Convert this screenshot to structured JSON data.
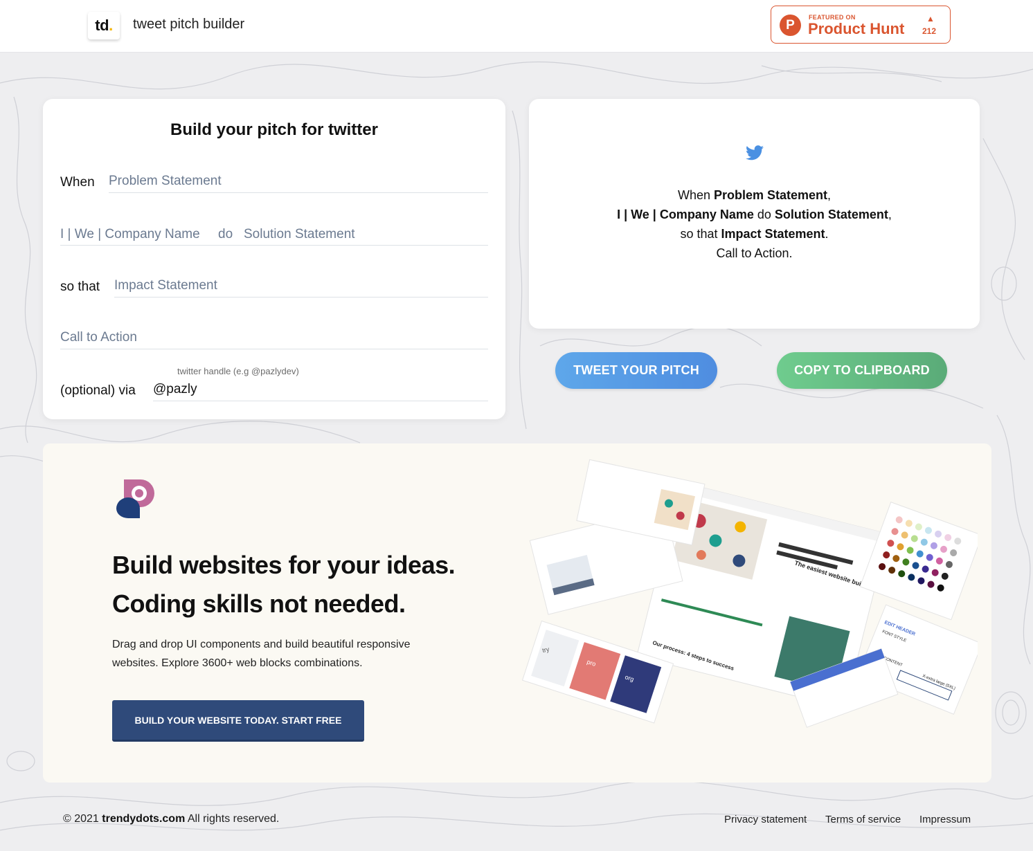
{
  "header": {
    "logo_text": "td",
    "logo_dot": ".",
    "app_title": "tweet pitch builder",
    "product_hunt": {
      "letter": "P",
      "featured": "FEATURED ON",
      "name": "Product Hunt",
      "arrow": "▲",
      "votes": "212"
    }
  },
  "form": {
    "title": "Build your pitch for twitter",
    "when_label": "When",
    "problem_placeholder": "Problem Statement",
    "company_placeholder": "I | We | Company Name",
    "do_label": "do",
    "solution_placeholder": "Solution Statement",
    "so_that_label": "so that",
    "impact_placeholder": "Impact Statement",
    "cta_placeholder": "Call to Action",
    "handle_hint": "twitter handle (e.g @pazlydev)",
    "via_label": "(optional) via",
    "handle_value": "@pazly"
  },
  "preview": {
    "line1_pre": "When ",
    "line1_bold": "Problem Statement",
    "line1_post": ",",
    "line2_bold1": "I | We | Company Name",
    "line2_mid": " do ",
    "line2_bold2": "Solution Statement",
    "line2_post": ",",
    "line3_pre": "so that ",
    "line3_bold": "Impact Statement",
    "line3_post": ".",
    "line4": "Call to Action."
  },
  "actions": {
    "tweet": "TWEET YOUR PITCH",
    "copy": "COPY TO CLIPBOARD"
  },
  "promo": {
    "heading1": "Build websites for your ideas.",
    "heading2": "Coding skills not needed.",
    "body": "Drag and drop UI components and build beautiful responsive websites. Explore 3600+ web blocks combinations.",
    "cta": "BUILD YOUR WEBSITE TODAY. START FREE",
    "collage_texts": {
      "easiest": "The easiest website builder you've used",
      "process": "Our process: 4 steps to success",
      "try": "try",
      "pro": "pro",
      "org": "org",
      "edit_header": "EDIT HEADER",
      "font_style": "FONT STYLE",
      "text_content": "TEXT CONTENT",
      "size": "X-extra large (5XL)"
    },
    "colors": {
      "logo_pink": "#c06a9a",
      "logo_blue": "#1f3f7a"
    }
  },
  "footer": {
    "copyright_pre": "© 2021 ",
    "brand": "trendydots.com",
    "copyright_post": " All rights reserved.",
    "links": [
      "Privacy statement",
      "Terms of service",
      "Impressum"
    ]
  }
}
